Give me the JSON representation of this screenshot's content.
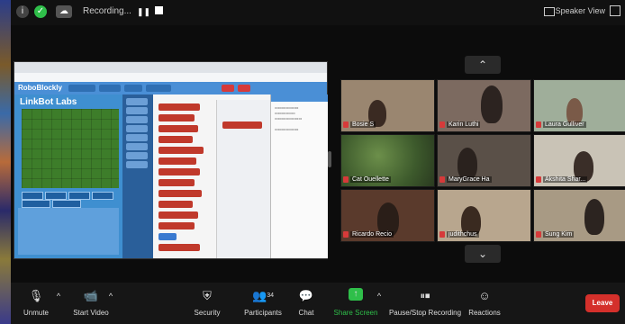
{
  "top_bar": {
    "recording_label": "Recording...",
    "view_label": "Speaker View"
  },
  "shared_screen": {
    "app_logo": "RoboBlockly",
    "sim_title": "LinkBot Labs"
  },
  "participants": [
    {
      "name": "Bosie S"
    },
    {
      "name": "Karin Luthi"
    },
    {
      "name": "Laura Gulliver"
    },
    {
      "name": "Cat Ouellette"
    },
    {
      "name": "MaryGrace Ha"
    },
    {
      "name": "Akshita Shar..."
    },
    {
      "name": "Ricardo Recio"
    },
    {
      "name": "judithchus"
    },
    {
      "name": "Sung Kim"
    }
  ],
  "controls": {
    "unmute": "Unmute",
    "start_video": "Start Video",
    "security": "Security",
    "participants": "Participants",
    "participants_count": "34",
    "chat": "Chat",
    "share_screen": "Share Screen",
    "pause_recording": "Pause/Stop Recording",
    "reactions": "Reactions",
    "leave": "Leave"
  },
  "colors": {
    "share_screen_accent": "#2fbf4a",
    "leave_button": "#d4302b"
  }
}
